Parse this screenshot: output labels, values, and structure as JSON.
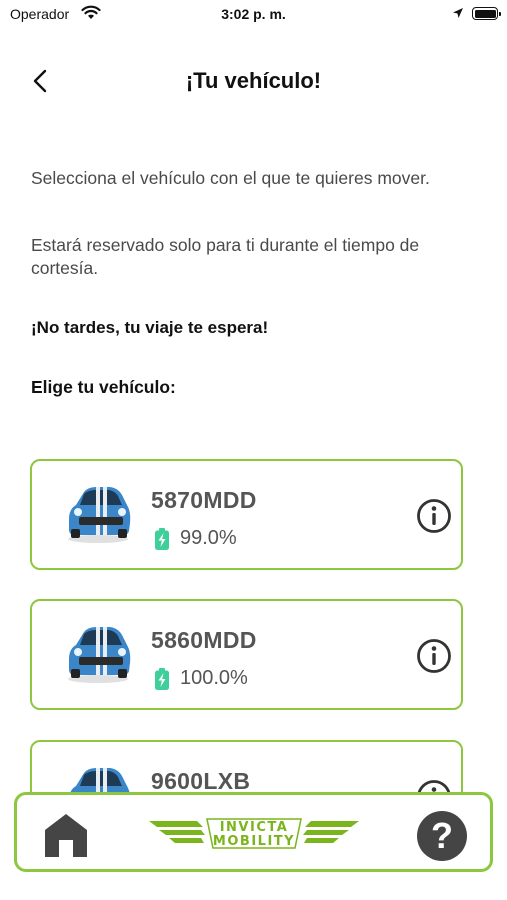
{
  "status_bar": {
    "carrier": "Operador",
    "time": "3:02 p. m."
  },
  "header": {
    "title": "¡Tu vehículo!"
  },
  "content": {
    "intro_1": "Selecciona el vehículo con el que te quieres mover.",
    "intro_2": "Estará reservado solo para ti durante el tiempo de cortesía.",
    "warning": "¡No tardes, tu viaje te espera!",
    "choose_label": "Elige tu vehículo:"
  },
  "vehicles": [
    {
      "plate": "5870MDD",
      "charge": "99.0%"
    },
    {
      "plate": "5860MDD",
      "charge": "100.0%"
    },
    {
      "plate": "9600LXB",
      "charge": ""
    }
  ],
  "bottom_nav": {
    "logo_line_1": "INVICTA",
    "logo_line_2": "MOBILITY",
    "help_symbol": "?"
  },
  "colors": {
    "accent": "#8dc63f",
    "car_body": "#3a86c8",
    "icons": "#454545"
  }
}
